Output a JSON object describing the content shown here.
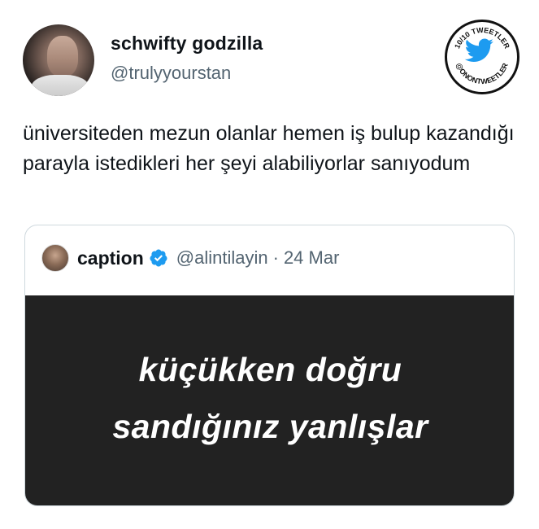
{
  "tweet": {
    "display_name": "schwifty godzilla",
    "handle": "@trulyyourstan",
    "text": "üniversiteden mezun olanlar hemen iş bulup kazandığı parayla istedikleri her şeyi alabiliyorlar sanıyodum"
  },
  "badge": {
    "top_text": "10/10 TWEETLER",
    "bottom_text": "@ONONTWEETLER",
    "icon": "twitter-bird-icon",
    "bird_color": "#1d9bf0"
  },
  "quote": {
    "name": "caption",
    "handle": "@alintilayin",
    "separator": "·",
    "date": "24 Mar",
    "verified_icon": "verified-badge-icon",
    "verified_color": "#1d9bf0",
    "image_line1": "küçükken doğru",
    "image_line2": "sandığınız yanlışlar"
  }
}
